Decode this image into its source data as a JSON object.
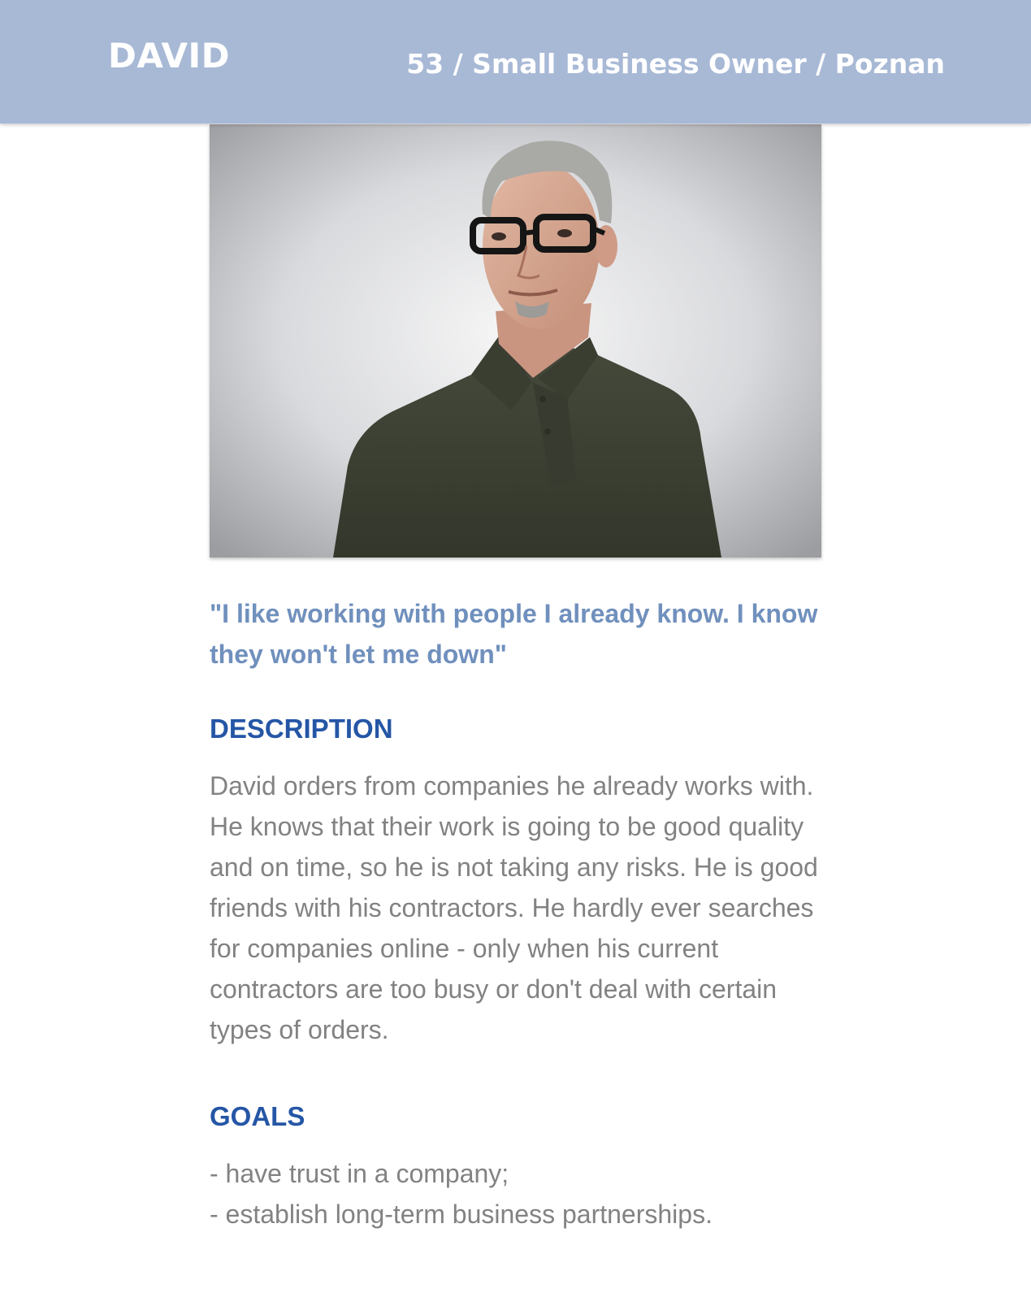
{
  "persona": {
    "name": "DAVID",
    "meta": "53 / Small Business Owner / Poznan"
  },
  "photo": {
    "icon": "persona-portrait-photo",
    "background_color": "#dcdde0",
    "shirt_color": "#3d4233"
  },
  "quote": "\"I like working with people I already know. I know they won't let me down\"",
  "description": {
    "heading": "DESCRIPTION",
    "text": "David orders from companies he already works with. He knows that their work is going to be good quality and on time, so he is not taking any risks. He is good friends with his contractors. He hardly ever searches for companies online - only when his current contractors are too busy or don't deal with certain types of orders."
  },
  "goals": {
    "heading": "GOALS",
    "items": [
      "- have trust in a company;",
      "- establish long-term business partnerships."
    ]
  },
  "colors": {
    "header_bg": "#a8b9d6",
    "quote": "#7090bd",
    "heading": "#2556a6",
    "body_text": "#828282"
  }
}
